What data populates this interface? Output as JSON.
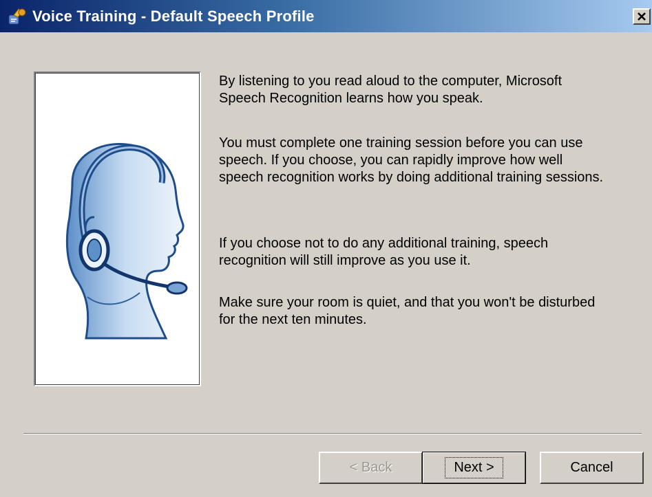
{
  "window": {
    "title": "Voice Training - Default Speech Profile",
    "icon": "speech-microphone-icon",
    "close_glyph": "x"
  },
  "content": {
    "paragraphs": [
      "By listening to you read aloud to the computer, Microsoft Speech Recognition learns how you speak.",
      "You must complete one training session before you can use speech.  If you choose, you can rapidly improve how well speech recognition works by doing additional training sessions.",
      "If you choose not to do any additional training, speech recognition will still improve as you use it.",
      "Make sure your room is quiet, and that you won't be disturbed for the next ten minutes."
    ],
    "illustration": "headset-head-illustration"
  },
  "buttons": {
    "back": {
      "label": "< Back",
      "enabled": false
    },
    "next": {
      "label": "Next >",
      "enabled": true,
      "default": true
    },
    "cancel": {
      "label": "Cancel",
      "enabled": true
    }
  },
  "colors": {
    "dialog_bg": "#d4d0c8",
    "titlebar_start": "#0a246a",
    "titlebar_end": "#a6caf0"
  }
}
